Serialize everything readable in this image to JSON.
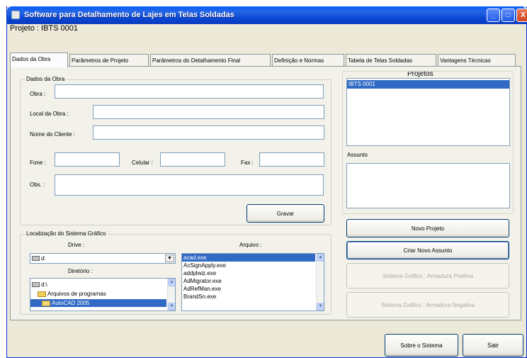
{
  "window": {
    "title": "Software para Detalhamento de Lajes em Telas Soldadas",
    "min_glyph": "_",
    "max_glyph": "□",
    "close_glyph": "X"
  },
  "project_label": "Projeto :  IBTS 0001",
  "tabs": [
    {
      "label": "Dados da Obra",
      "active": true
    },
    {
      "label": "Parâmetros de Projeto",
      "active": false
    },
    {
      "label": "Parâmetros do Detalhamento Final",
      "active": false
    },
    {
      "label": "Definição e Normas",
      "active": false
    },
    {
      "label": "Tabela de Telas Soldadas",
      "active": false
    },
    {
      "label": "Vantagens Técnicas",
      "active": false
    }
  ],
  "dados_obra": {
    "group_title": "Dados da Obra",
    "obra_label": "Obra :",
    "obra_value": "",
    "local_label": "Local da Obra :",
    "local_value": "",
    "cliente_label": "Nome do Cliente :",
    "cliente_value": "",
    "fone_label": "Fone :",
    "fone_value": "",
    "celular_label": "Celular :",
    "celular_value": "",
    "fax_label": "Fax :",
    "fax_value": "",
    "obs_label": "Obs. :",
    "obs_value": "",
    "gravar_button": "Gravar"
  },
  "projetos": {
    "title": "Projetos",
    "items": [
      "IBTS 0001"
    ],
    "assunto_label": "Assunto"
  },
  "buttons": {
    "novo_projeto": "Novo Projeto",
    "criar_assunto": "Criar Novo Assunto",
    "armadura_positiva": "Sistema Gráfico : Armadura Positiva",
    "armadura_negativa": "Sistema Gráfico : Armadura Negativa",
    "sobre": "Sobre o Sistema",
    "sair": "Sair"
  },
  "localizacao": {
    "group_title": "Localização do Sistema Gráfico",
    "drive_label": "Drive :",
    "drive_value": "d:",
    "diretorio_label": "Diretório :",
    "directories": [
      {
        "name": "d:\\",
        "icon": "drive-icon",
        "indent": 0,
        "selected": false
      },
      {
        "name": "Arquivos de programas",
        "icon": "folder-icon",
        "indent": 1,
        "selected": false
      },
      {
        "name": "AutoCAD 2005",
        "icon": "folder-open-icon",
        "indent": 2,
        "selected": true
      }
    ],
    "arquivo_label": "Arquivo :",
    "files": [
      {
        "name": "acad.exe",
        "selected": true
      },
      {
        "name": "AcSignApply.exe",
        "selected": false
      },
      {
        "name": "addplwiz.exe",
        "selected": false
      },
      {
        "name": "AdMigrator.exe",
        "selected": false
      },
      {
        "name": "AdRefMan.exe",
        "selected": false
      },
      {
        "name": "BrandSn.exe",
        "selected": false
      }
    ]
  }
}
